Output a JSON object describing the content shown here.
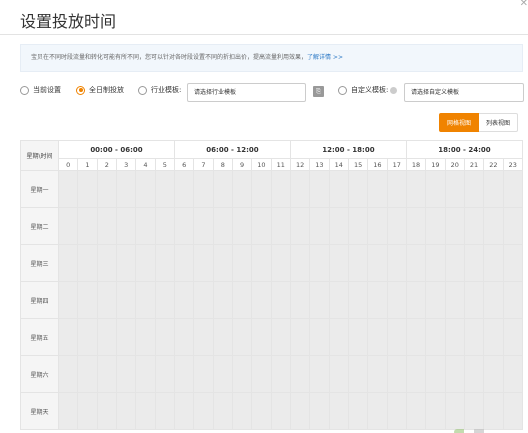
{
  "dialog": {
    "title": "设置投放时间",
    "close_icon": "close-icon"
  },
  "tip": {
    "text": "宝贝在不同时段流量和转化可能有所不同，您可以针对各时段设置不同的折扣出价，提高流量利用效果，",
    "link": "了解详情 >>"
  },
  "options": {
    "current_setting": "当前设置",
    "full_day": "全日制投放",
    "industry_template": "行业模板:",
    "industry_placeholder": "请选择行业模板",
    "custom_template": "自定义模板:",
    "custom_placeholder": "请选择自定义模板",
    "selected": "full_day"
  },
  "views": {
    "grid_view": "网格视图",
    "list_view": "列表视图",
    "active": "grid_view"
  },
  "schedule": {
    "corner_label": "星期\\时间",
    "periods": [
      "00:00 - 06:00",
      "06:00 - 12:00",
      "12:00 - 18:00",
      "18:00 - 24:00"
    ],
    "hours": [
      "0",
      "1",
      "2",
      "3",
      "4",
      "5",
      "6",
      "7",
      "8",
      "9",
      "10",
      "11",
      "12",
      "13",
      "14",
      "15",
      "16",
      "17",
      "18",
      "19",
      "20",
      "21",
      "22",
      "23"
    ],
    "days": [
      "星期一",
      "星期二",
      "星期三",
      "星期四",
      "星期五",
      "星期六",
      "星期天"
    ]
  },
  "colors": {
    "accent": "#f08300",
    "link": "#2b78c5",
    "cell": "#ebebeb"
  }
}
